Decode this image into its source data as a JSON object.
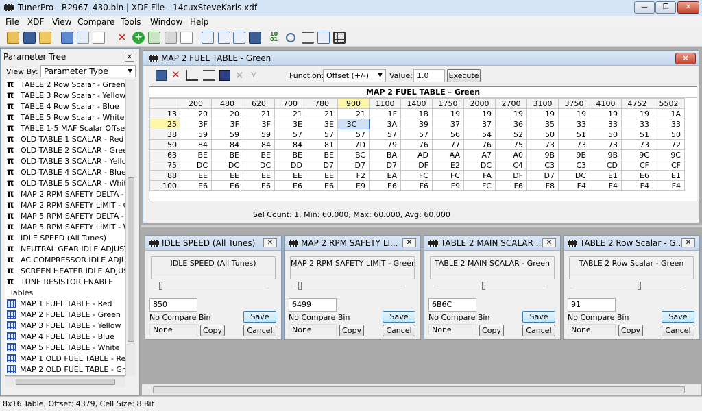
{
  "app": {
    "title": "TunerPro  -  R2967_430.bin | XDF File - 14cuxSteveKarls.xdf",
    "window_buttons": [
      "—",
      "❐",
      "✕"
    ]
  },
  "menu": [
    "File",
    "XDF",
    "View",
    "Compare",
    "Tools",
    "Window",
    "Help"
  ],
  "toolbar_icons": [
    "open-icon",
    "save-icon",
    "folder-icon",
    "bin-icon",
    "compare-icon",
    "new-icon",
    "delete-icon",
    "add-icon",
    "copy-icon",
    "wrench-icon",
    "page-icon",
    "layout-icon",
    "layout2-icon",
    "window-icon",
    "monitor-icon",
    "binary-icon",
    "search-icon",
    "scale-icon",
    "tree-icon",
    "table-icon"
  ],
  "param_tree": {
    "title": "Parameter Tree",
    "close": "✕",
    "view_by_label": "View By:",
    "view_by_value": "Parameter Type",
    "scalars": [
      "TABLE 2  Row Scalar - Green",
      "TABLE 3  Row Scalar - Yellow",
      "TABLE 4  Row Scalar - Blue",
      "TABLE 5  Row Scalar - White",
      "TABLE 1-5 MAF Scalar Offset",
      "OLD TABLE 1 SCALAR - Red",
      "OLD TABLE 2 SCALAR - Green",
      "OLD TABLE 3 SCALAR - Yellow",
      "OLD TABLE 4 SCALAR - Blue",
      "OLD TABLE 5 SCALAR - White",
      "MAP 2 RPM SAFETY DELTA - Gr",
      "MAP 2 RPM SAFETY LIMIT - Gre",
      "MAP 5 RPM SAFETY DELTA - W",
      "MAP 5 RPM SAFETY LIMIT - Wh",
      "IDLE SPEED (All Tunes)",
      "NEUTRAL GEAR IDLE ADJUSTM",
      "AC COMPRESSOR IDLE ADJUST",
      "SCREEN HEATER IDLE ADJUSTI",
      "TUNE RESISTOR ENABLE"
    ],
    "tables_header": "Tables",
    "tables": [
      "MAP 1 FUEL TABLE - Red",
      "MAP 2 FUEL TABLE - Green",
      "MAP 3 FUEL TABLE - Yellow",
      "MAP 4 FUEL TABLE - Blue",
      "MAP 5 FUEL TABLE - White",
      "MAP 1 OLD FUEL TABLE - Red",
      "MAP 2 OLD FUEL TABLE - Greer",
      "MAP 3 OLD FUEL TABLE - Yello"
    ]
  },
  "fuel_window": {
    "title": "MAP 2 FUEL TABLE - Green",
    "close": "✕",
    "function_label": "Function:",
    "function_value": "Offset (+/-)",
    "value_label": "Value:",
    "value": "1.0",
    "execute": "Execute",
    "table_title": "MAP 2 FUEL TABLE – Green",
    "columns": [
      "200",
      "480",
      "620",
      "700",
      "780",
      "900",
      "1100",
      "1400",
      "1750",
      "2000",
      "2700",
      "3100",
      "3750",
      "4100",
      "4752",
      "5502"
    ],
    "rows": [
      {
        "label": "13",
        "cells": [
          "20",
          "20",
          "21",
          "21",
          "21",
          "21",
          "1F",
          "1B",
          "19",
          "19",
          "19",
          "19",
          "19",
          "19",
          "19",
          "1A"
        ]
      },
      {
        "label": "25",
        "cells": [
          "3F",
          "3F",
          "3F",
          "3E",
          "3E",
          "3C",
          "3A",
          "39",
          "37",
          "37",
          "36",
          "35",
          "33",
          "33",
          "33",
          "33"
        ]
      },
      {
        "label": "38",
        "cells": [
          "59",
          "59",
          "59",
          "57",
          "57",
          "57",
          "57",
          "57",
          "56",
          "54",
          "52",
          "50",
          "51",
          "50",
          "51",
          "50"
        ]
      },
      {
        "label": "50",
        "cells": [
          "84",
          "84",
          "84",
          "84",
          "81",
          "7D",
          "79",
          "76",
          "77",
          "76",
          "75",
          "73",
          "73",
          "73",
          "73",
          "72"
        ]
      },
      {
        "label": "63",
        "cells": [
          "BE",
          "BE",
          "BE",
          "BE",
          "BE",
          "BC",
          "BA",
          "AD",
          "AA",
          "A7",
          "A0",
          "9B",
          "9B",
          "9B",
          "9C",
          "9C"
        ]
      },
      {
        "label": "75",
        "cells": [
          "DC",
          "DC",
          "DC",
          "DD",
          "D7",
          "D7",
          "D7",
          "DF",
          "E2",
          "DC",
          "C4",
          "C3",
          "C3",
          "CD",
          "CF",
          "CF"
        ]
      },
      {
        "label": "88",
        "cells": [
          "EE",
          "EE",
          "EE",
          "EE",
          "EE",
          "F2",
          "EA",
          "FC",
          "FC",
          "FA",
          "DF",
          "D7",
          "DC",
          "E1",
          "E6",
          "E1"
        ]
      },
      {
        "label": "100",
        "cells": [
          "E6",
          "E6",
          "E6",
          "E6",
          "E6",
          "E9",
          "E6",
          "F6",
          "F9",
          "FC",
          "F6",
          "F8",
          "F4",
          "F4",
          "F4",
          "F4"
        ]
      }
    ],
    "status": "Sel Count: 1, Min: 60.000, Max: 60.000, Avg: 60.000"
  },
  "sub_windows": [
    {
      "title": "IDLE SPEED (All Tunes)",
      "header": "IDLE SPEED (All Tunes)",
      "value": "850",
      "compare_label": "No Compare Bin",
      "compare_value": "None",
      "save": "Save",
      "copy": "Copy",
      "cancel": "Cancel",
      "close": "✕"
    },
    {
      "title": "MAP 2 RPM SAFETY LI...",
      "header": "MAP 2 RPM SAFETY LIMIT - Green",
      "value": "6499",
      "compare_label": "No Compare Bin",
      "compare_value": "None",
      "save": "Save",
      "copy": "Copy",
      "cancel": "Cancel",
      "close": "✕"
    },
    {
      "title": "TABLE 2 MAIN SCALAR ...",
      "header": "TABLE 2 MAIN SCALAR - Green",
      "value": "6B6C",
      "compare_label": "No Compare Bin",
      "compare_value": "None",
      "save": "Save",
      "copy": "Copy",
      "cancel": "Cancel",
      "close": "✕"
    },
    {
      "title": "TABLE 2  Row Scalar - G...",
      "header": "TABLE 2  Row Scalar - Green",
      "value": "91",
      "compare_label": "No Compare Bin",
      "compare_value": "None",
      "save": "Save",
      "copy": "Copy",
      "cancel": "Cancel",
      "close": "✕"
    }
  ],
  "statusbar": "8x16 Table, Offset: 4379,  Cell Size: 8 Bit"
}
